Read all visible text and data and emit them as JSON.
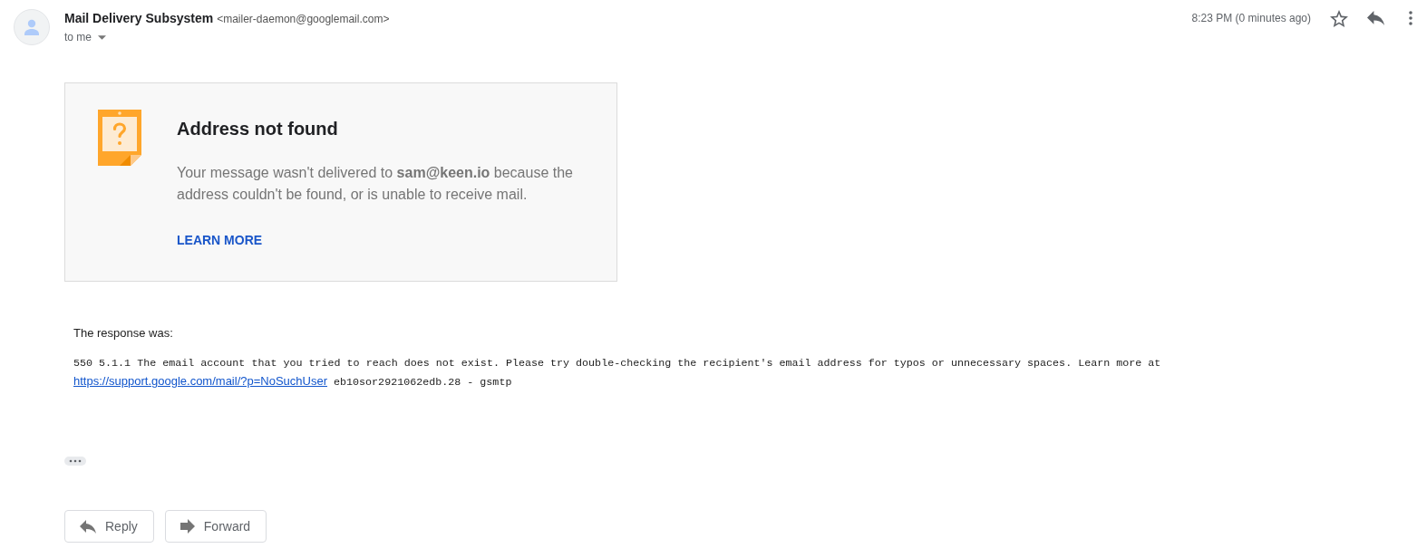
{
  "header": {
    "sender_name": "Mail Delivery Subsystem",
    "sender_email": "<mailer-daemon@googlemail.com>",
    "recipient": "to me",
    "time": "8:23 PM (0 minutes ago)",
    "starred": false
  },
  "notice": {
    "title": "Address not found",
    "message": "Your message wasn't delivered to **sam@keen.io** because the address couldn't be found, or is unable to receive mail.",
    "link": "LEARN MORE"
  },
  "response": {
    "label": "The response was:",
    "text": "550 5.1.1 The email account that you tried to reach does not exist. Please try double-checking the recipient's email address for typos or unnecessary spaces. Learn more at",
    "link": "https://support.google.com/mail/?p=NoSuchUser",
    "trailer": "eb10sor2921062edb.28 - gsmtp"
  },
  "actions": [
    {
      "label": "Reply",
      "kind": "reply"
    },
    {
      "label": "Forward",
      "kind": "forward"
    }
  ]
}
